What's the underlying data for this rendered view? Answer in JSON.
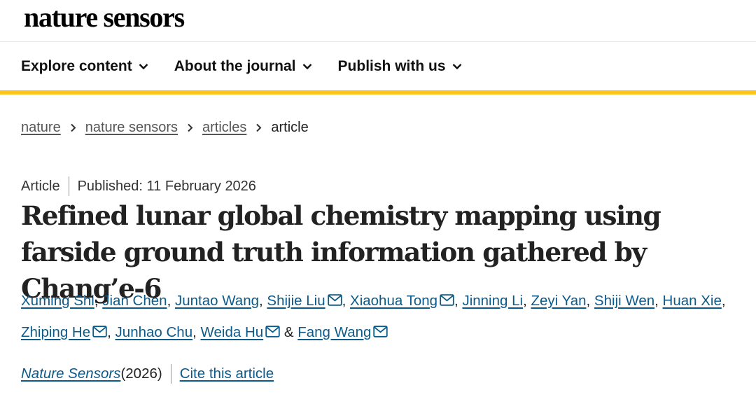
{
  "header": {
    "logo_text": "nature sensors"
  },
  "nav": {
    "items": [
      {
        "label": "Explore content"
      },
      {
        "label": "About the journal"
      },
      {
        "label": "Publish with us"
      }
    ]
  },
  "breadcrumb": {
    "items": [
      "nature",
      "nature sensors",
      "articles"
    ],
    "current": "article"
  },
  "article": {
    "type": "Article",
    "published": "Published: 11 February 2026",
    "title": "Refined lunar global chemistry mapping using farside ground truth information gathered by Chang’e-6",
    "authors": [
      {
        "name": "Xuming Shi",
        "email": false
      },
      {
        "name": "Jian Chen",
        "email": false
      },
      {
        "name": "Juntao Wang",
        "email": false
      },
      {
        "name": "Shijie Liu",
        "email": true
      },
      {
        "name": "Xiaohua Tong",
        "email": true
      },
      {
        "name": "Jinning Li",
        "email": false
      },
      {
        "name": "Zeyi Yan",
        "email": false
      },
      {
        "name": "Shiji Wen",
        "email": false
      },
      {
        "name": "Huan Xie",
        "email": false
      },
      {
        "name": "Zhiping He",
        "email": true
      },
      {
        "name": "Junhao Chu",
        "email": false
      },
      {
        "name": "Weida Hu",
        "email": true
      },
      {
        "name": "Fang Wang",
        "email": true
      }
    ],
    "separator": ", ",
    "last_separator": " & ",
    "journal": "Nature Sensors",
    "year": " (2026)",
    "cite_label": "Cite this article"
  },
  "colors": {
    "accent_bar": "#fdc41d",
    "link": "#0c5a8a"
  },
  "icons": {
    "nav_dropdown": "chevron-down-icon",
    "breadcrumb_separator": "chevron-right-icon",
    "author_contact": "mail-icon"
  }
}
